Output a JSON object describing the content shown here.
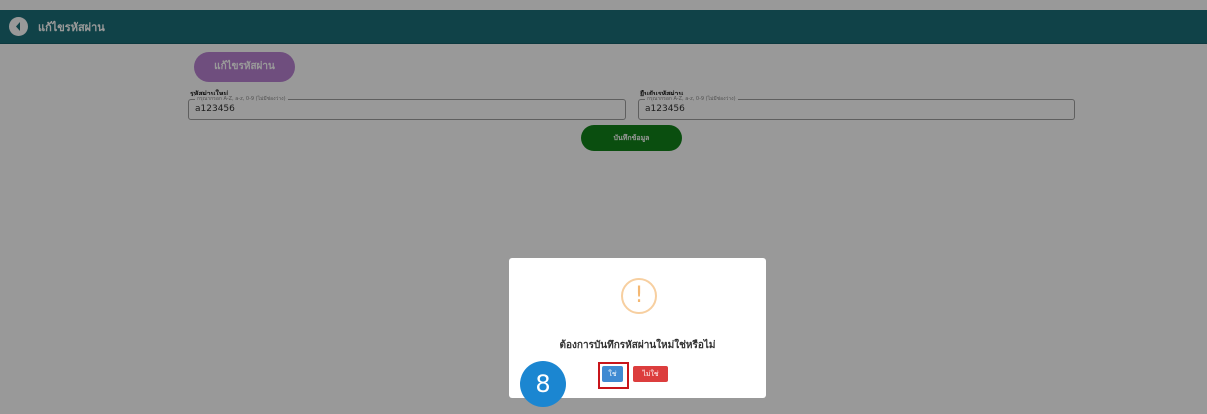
{
  "header": {
    "title": "แก้ไขรหัสผ่าน",
    "back_icon": "back-arrow-circle-icon"
  },
  "form": {
    "section_button": "แก้ไขรหัสผ่าน",
    "new_password": {
      "label": "รหัสผ่านใหม่",
      "legend": "กรุณากรอก A-Z, a-z, 0-9 (ไม่มีช่องว่าง)",
      "value": "a123456"
    },
    "confirm_password": {
      "label": "ยืนยันรหัสผ่าน",
      "legend": "กรุณากรอก A-Z, a-z, 0-9 (ไม่มีช่องว่าง)",
      "value": "a123456"
    },
    "save_button": "บันทึกข้อมูล"
  },
  "dialog": {
    "icon": "warning-circle-icon",
    "icon_glyph": "!",
    "message": "ต้องการบันทึกรหัสผ่านใหม่ใช่หรือไม่",
    "confirm_label": "ใช่",
    "cancel_label": "ไม่ใช่"
  },
  "annotation": {
    "step_number": "8"
  },
  "colors": {
    "header": "#1b6f78",
    "section_button": "#b983d3",
    "save_button": "#12821a",
    "confirm_button": "#3f8ad2",
    "cancel_button": "#dc3d3d",
    "highlight": "#c8151b",
    "badge": "#1b86d1"
  }
}
